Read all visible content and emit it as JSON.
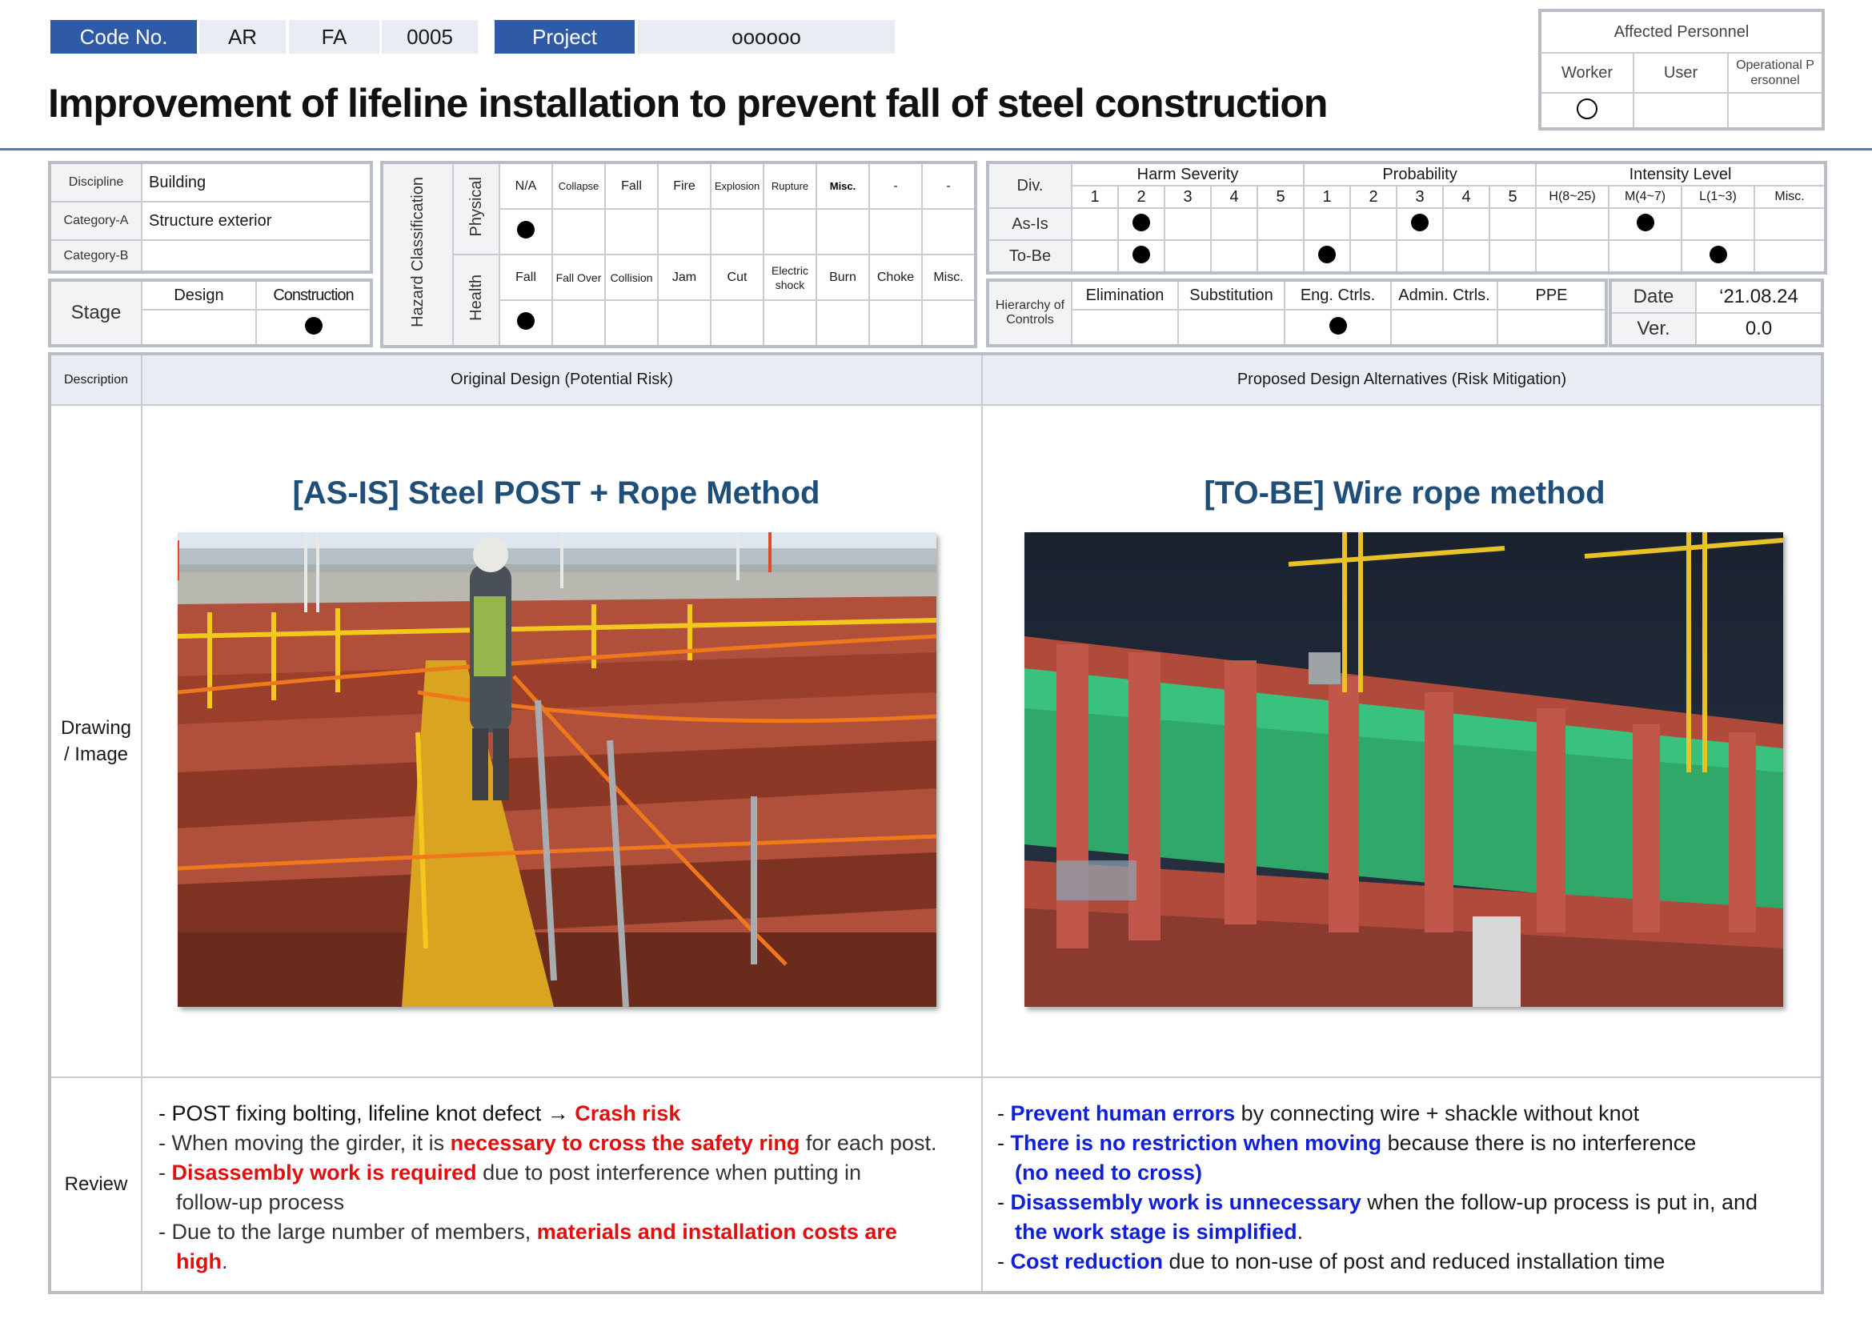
{
  "code_bar": {
    "code_label": "Code No.",
    "code_1": "AR",
    "code_2": "FA",
    "code_3": "0005",
    "project_label": "Project",
    "project_value": "oooooo"
  },
  "title": "Improvement of lifeline installation to prevent fall of steel construction",
  "affected_personnel": {
    "header": "Affected Personnel",
    "worker": "Worker",
    "user": "User",
    "operational": "Operational P ersonnel"
  },
  "info": {
    "discipline_label": "Discipline",
    "discipline_value": "Building",
    "category_a_label": "Category-A",
    "category_a_value": "Structure exterior",
    "category_b_label": "Category-B",
    "category_b_value": ""
  },
  "stage": {
    "label": "Stage",
    "design": "Design",
    "construction": "Construction"
  },
  "hazard": {
    "label": "Hazard Classification",
    "physical_label": "Physical",
    "health_label": "Health",
    "physical_items": [
      "N/A",
      "Collapse",
      "Fall",
      "Fire",
      "Explosion",
      "Rupture",
      "Misc.",
      "-",
      "-"
    ],
    "health_items": [
      "Fall",
      "Fall Over",
      "Collision",
      "Jam",
      "Cut",
      "Electric shock",
      "Burn",
      "Choke",
      "Misc."
    ]
  },
  "risk": {
    "div_label": "Div.",
    "harm_severity": "Harm Severity",
    "probability": "Probability",
    "intensity_level": "Intensity Level",
    "scale": [
      "1",
      "2",
      "3",
      "4",
      "5"
    ],
    "intensity_cols": [
      "H(8~25)",
      "M(4~7)",
      "L(1~3)",
      "Misc."
    ],
    "as_is": "As-Is",
    "to_be": "To-Be"
  },
  "controls": {
    "label": "Hierarchy of Controls",
    "items": [
      "Elimination",
      "Substitution",
      "Eng. Ctrls.",
      "Admin. Ctrls.",
      "PPE"
    ]
  },
  "meta": {
    "date_label": "Date",
    "date_value": "‘21.08.24",
    "ver_label": "Ver.",
    "ver_value": "0.0"
  },
  "description": {
    "label": "Description",
    "original_header": "Original Design (Potential Risk)",
    "proposed_header": "Proposed Design Alternatives (Risk Mitigation)",
    "drawing_label": "Drawing / Image",
    "review_label": "Review",
    "as_is_title": "[AS-IS] Steel POST + Rope Method",
    "to_be_title": "[TO-BE] Wire rope method"
  },
  "review_left": {
    "l1a": "- POST fixing bolting, lifeline knot defect → ",
    "l1b": "Crash risk",
    "l2a": "- When moving the girder, it is ",
    "l2b": "necessary to cross the safety ring",
    "l2c": " for each post.",
    "l3a": "- ",
    "l3b": "Disassembly work is required",
    "l3c": " due to post interference when putting in",
    "l4": "follow-up process",
    "l5a": "- Due to the large number of members, ",
    "l5b": "materials and installation costs are",
    "l6": "high",
    "l6end": "."
  },
  "review_right": {
    "l1a": "- ",
    "l1b": "Prevent human errors",
    "l1c": " by connecting wire + shackle without knot",
    "l2a": "- ",
    "l2b": "There is no restriction when moving",
    "l2c": " because there is no interference",
    "l3": "(no need to cross)",
    "l4a": "- ",
    "l4b": "Disassembly work is unnecessary",
    "l4c": " when the follow-up process is put in, and",
    "l5": "the work stage is simplified",
    "l5end": ".",
    "l6a": "- ",
    "l6b": "Cost reduction",
    "l6c": " due to non-use of post and reduced installation time"
  },
  "colors": {
    "accent_blue": "#2e5aa8",
    "title_blue": "#1f4e79",
    "risk_red": "#e01010",
    "mitigation_blue": "#1020d8"
  }
}
